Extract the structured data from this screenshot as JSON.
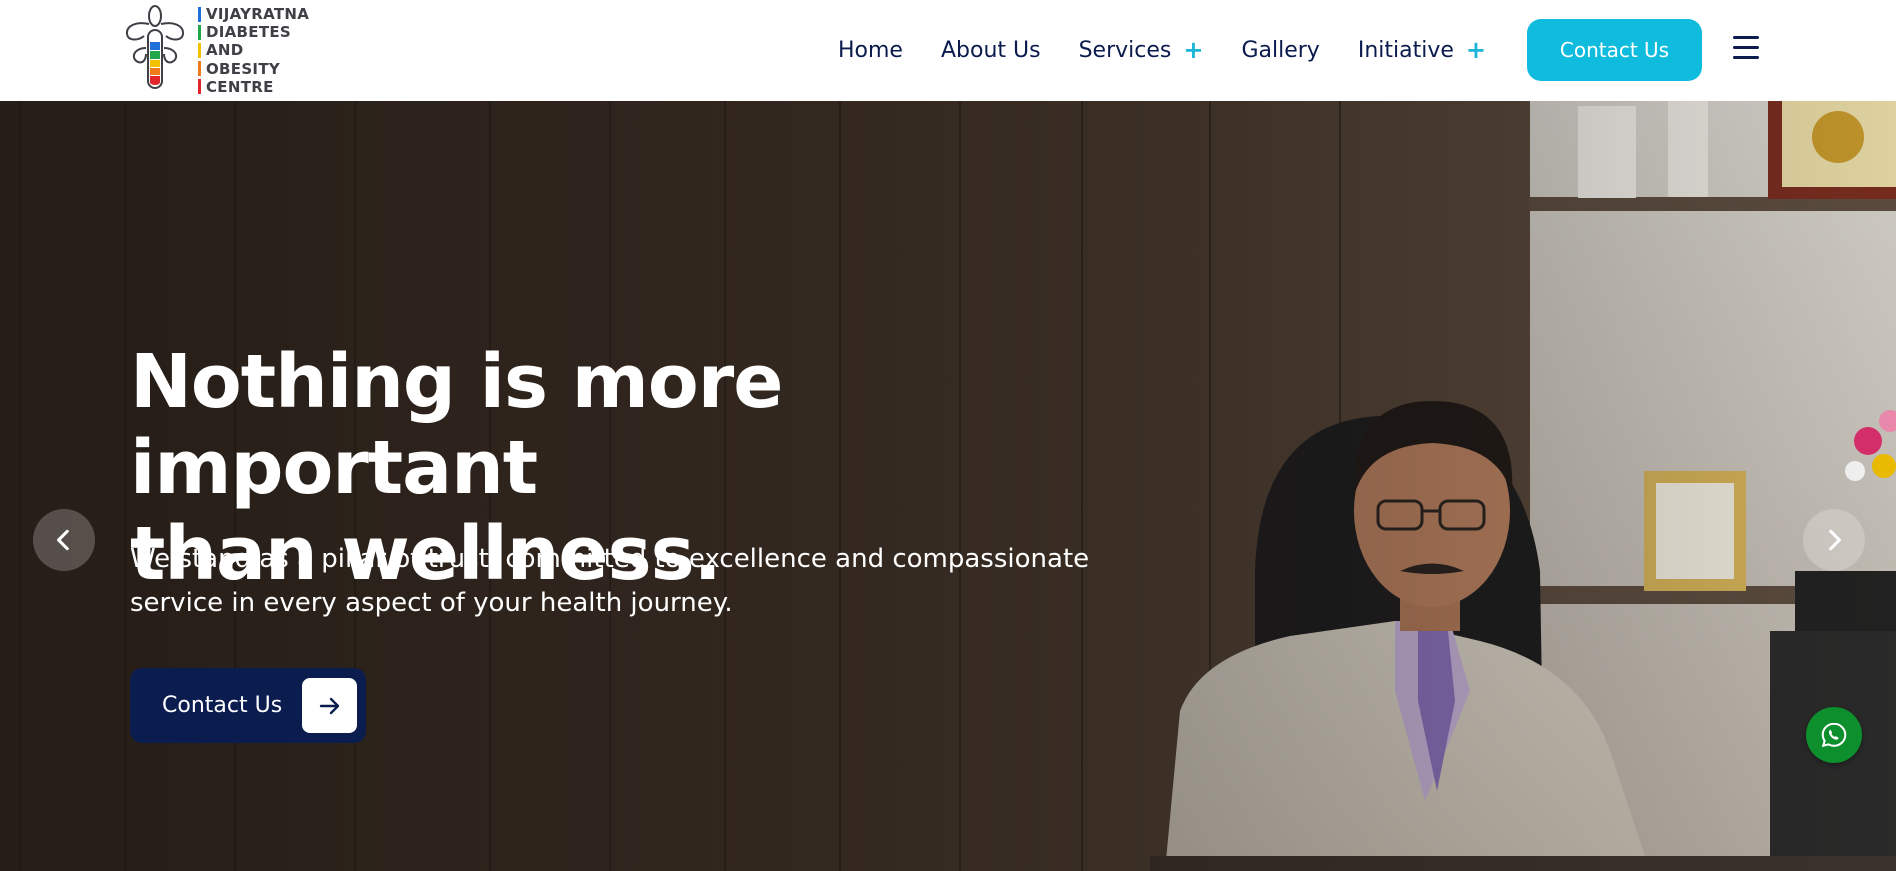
{
  "brand": {
    "logo_lines": [
      "VIJAYRATNA",
      "DIABETES",
      "AND",
      "OBESITY",
      "CENTRE"
    ],
    "logo_bar_colors": [
      "#1e6fd9",
      "#22a64a",
      "#f2c200",
      "#f07a1a",
      "#e0262b"
    ],
    "logo_icon": "figure-with-color-tube-icon"
  },
  "nav": {
    "items": [
      {
        "label": "Home",
        "has_dropdown": false
      },
      {
        "label": "About Us",
        "has_dropdown": false
      },
      {
        "label": "Services",
        "has_dropdown": true
      },
      {
        "label": "Gallery",
        "has_dropdown": false
      },
      {
        "label": "Initiative",
        "has_dropdown": true
      }
    ],
    "dropdown_icon": "plus-icon",
    "contact_label": "Contact Us",
    "menu_icon": "hamburger-menu-icon"
  },
  "hero": {
    "title_line1": "Nothing is more important",
    "title_line2": "than wellness.",
    "subtitle_line1": "We stand as a pillar of trust, committed to excellence and compassionate",
    "subtitle_line2": "service in every aspect of your health journey.",
    "cta_label": "Contact Us",
    "cta_icon": "arrow-right-icon",
    "prev_icon": "chevron-left-icon",
    "next_icon": "chevron-right-icon",
    "background_image": "doctor-in-office-photo"
  },
  "floating": {
    "whatsapp_icon": "whatsapp-icon"
  },
  "colors": {
    "accent": "#10bcde",
    "navy": "#0b1d4f",
    "whatsapp_green": "#0c8f2c"
  }
}
